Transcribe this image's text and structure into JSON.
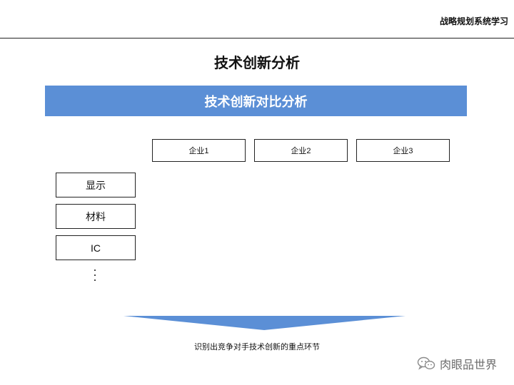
{
  "header": {
    "title": "战略规划系统学习"
  },
  "slide": {
    "title": "技术创新分析",
    "banner": {
      "text": "技术创新对比分析",
      "color": "#5b8fd6"
    },
    "companies": [
      "企业1",
      "企业2",
      "企业3"
    ],
    "categories": [
      "显示",
      "材料",
      "IC"
    ],
    "arrow_color": "#5b8fd6",
    "caption": "识别出竞争对手技术创新的重点环节"
  },
  "watermark": {
    "icon": "wechat-icon",
    "text": "肉眼品世界"
  }
}
